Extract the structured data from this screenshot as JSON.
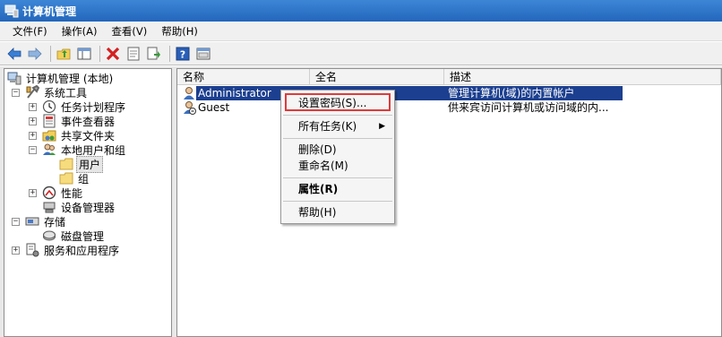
{
  "window": {
    "title": "计算机管理"
  },
  "menubar": {
    "items": [
      "文件(F)",
      "操作(A)",
      "查看(V)",
      "帮助(H)"
    ]
  },
  "toolbar": {
    "buttons": [
      "back-icon",
      "forward-icon",
      "up-folder-icon",
      "show-hide-tree-icon",
      "delete-icon",
      "properties-icon",
      "export-icon",
      "help-icon",
      "view-icon"
    ]
  },
  "tree": {
    "items": [
      {
        "label": "计算机管理 (本地)",
        "icon": "computer-icon"
      },
      {
        "label": "系统工具",
        "icon": "tools-icon",
        "expander": "−"
      },
      {
        "label": "任务计划程序",
        "icon": "clock-icon",
        "expander": "+"
      },
      {
        "label": "事件查看器",
        "icon": "event-icon",
        "expander": "+"
      },
      {
        "label": "共享文件夹",
        "icon": "share-icon",
        "expander": "+"
      },
      {
        "label": "本地用户和组",
        "icon": "users-icon",
        "expander": "−"
      },
      {
        "label": "用户",
        "icon": "folder-icon"
      },
      {
        "label": "组",
        "icon": "folder-icon"
      },
      {
        "label": "性能",
        "icon": "performance-icon",
        "expander": "+"
      },
      {
        "label": "设备管理器",
        "icon": "device-icon"
      },
      {
        "label": "存储",
        "icon": "storage-icon",
        "expander": "−"
      },
      {
        "label": "磁盘管理",
        "icon": "disk-icon"
      },
      {
        "label": "服务和应用程序",
        "icon": "services-icon",
        "expander": "+"
      }
    ]
  },
  "list": {
    "columns": [
      "名称",
      "全名",
      "描述"
    ],
    "rows": [
      {
        "name": "Administrator",
        "fullname": "",
        "description": "管理计算机(域)的内置帐户"
      },
      {
        "name": "Guest",
        "fullname": "",
        "description": "供来宾访问计算机或访问域的内..."
      }
    ]
  },
  "context_menu": {
    "items": [
      {
        "label": "设置密码(S)...",
        "bold": false
      },
      {
        "label": "所有任务(K)",
        "bold": false,
        "submenu": "▶"
      },
      {
        "label": "删除(D)",
        "bold": false
      },
      {
        "label": "重命名(M)",
        "bold": false
      },
      {
        "label": "属性(R)",
        "bold": true
      },
      {
        "label": "帮助(H)",
        "bold": false
      }
    ]
  },
  "colors": {
    "selection": "#1c3f8f",
    "highlight_box": "#e03a3a",
    "titlebar": "#2b6fc4"
  }
}
